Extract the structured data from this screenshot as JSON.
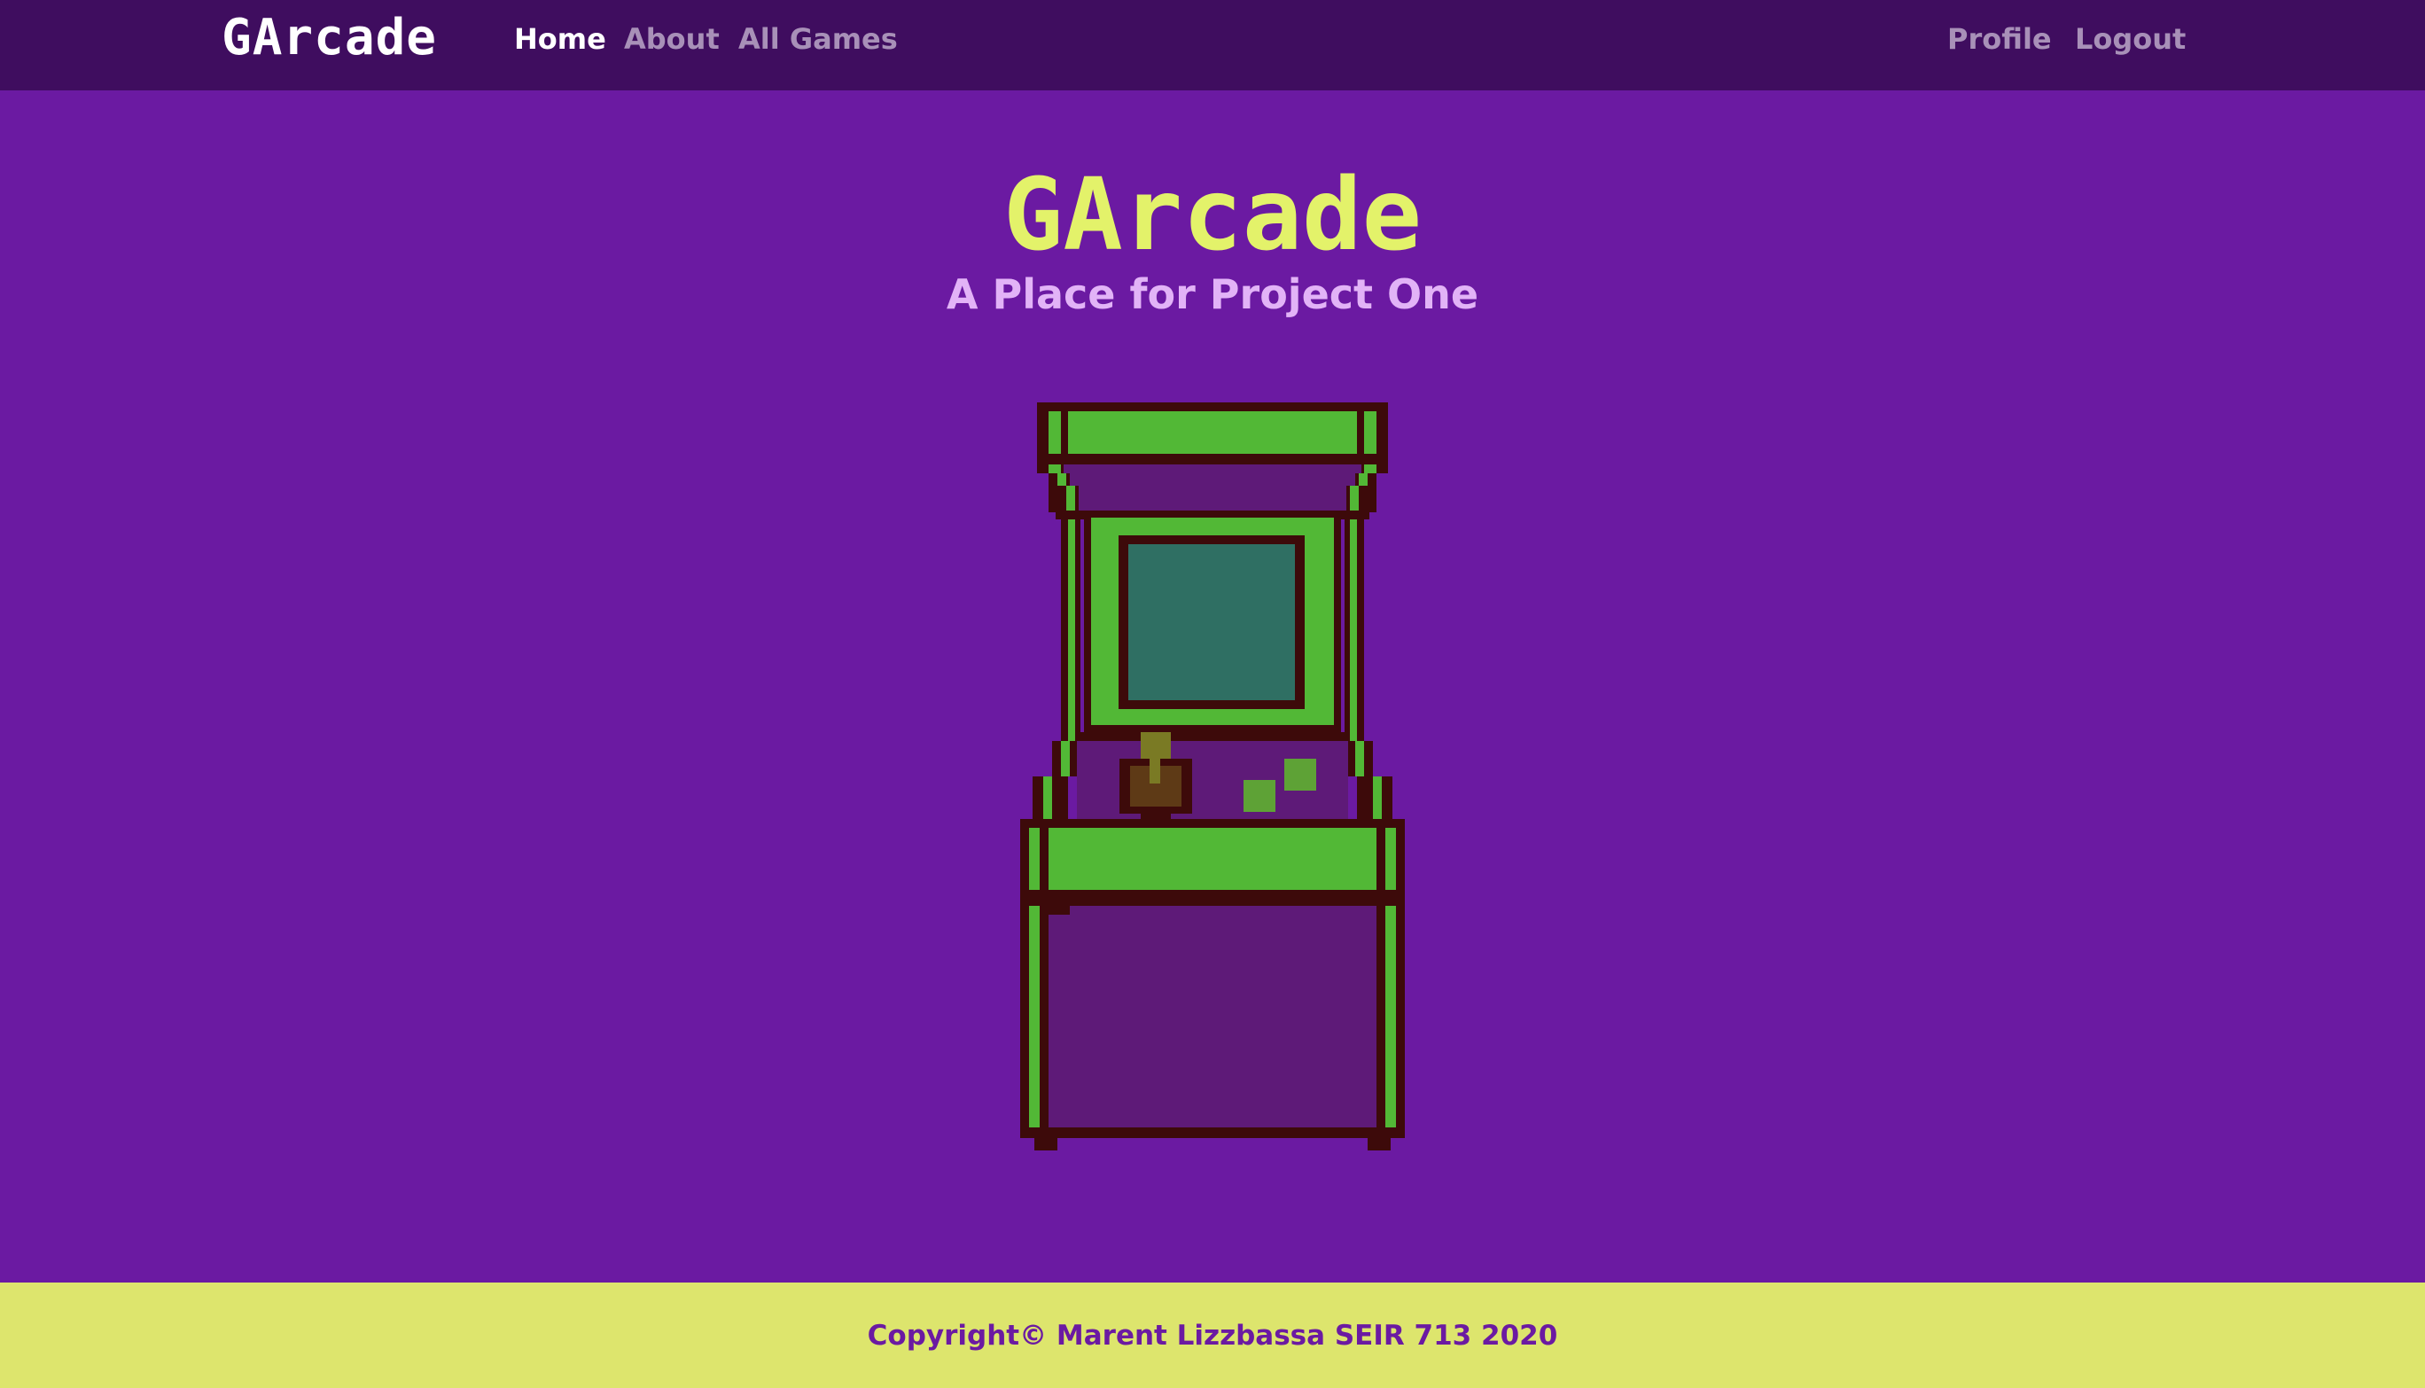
{
  "navbar": {
    "brand": "GArcade",
    "links": [
      {
        "label": "Home"
      },
      {
        "label": "About"
      },
      {
        "label": "All Games"
      }
    ],
    "right_links": [
      {
        "label": "Profile"
      },
      {
        "label": "Logout"
      }
    ],
    "background_color": "#3f0d5f"
  },
  "hero": {
    "title": "GArcade",
    "subtitle": "A Place for Project One",
    "title_color": "#e3f26a",
    "subtitle_color": "#e2b3f7",
    "illustration": "arcade-cabinet-icon"
  },
  "footer": {
    "text": "Copyright© Marent Lizzbassa SEIR 713 2020",
    "background_color": "#dde56d"
  },
  "colors": {
    "page_background": "#6b1aa2",
    "accent_green": "#52b836",
    "outline": "#3d0a0a",
    "screen": "#2f6f63"
  }
}
